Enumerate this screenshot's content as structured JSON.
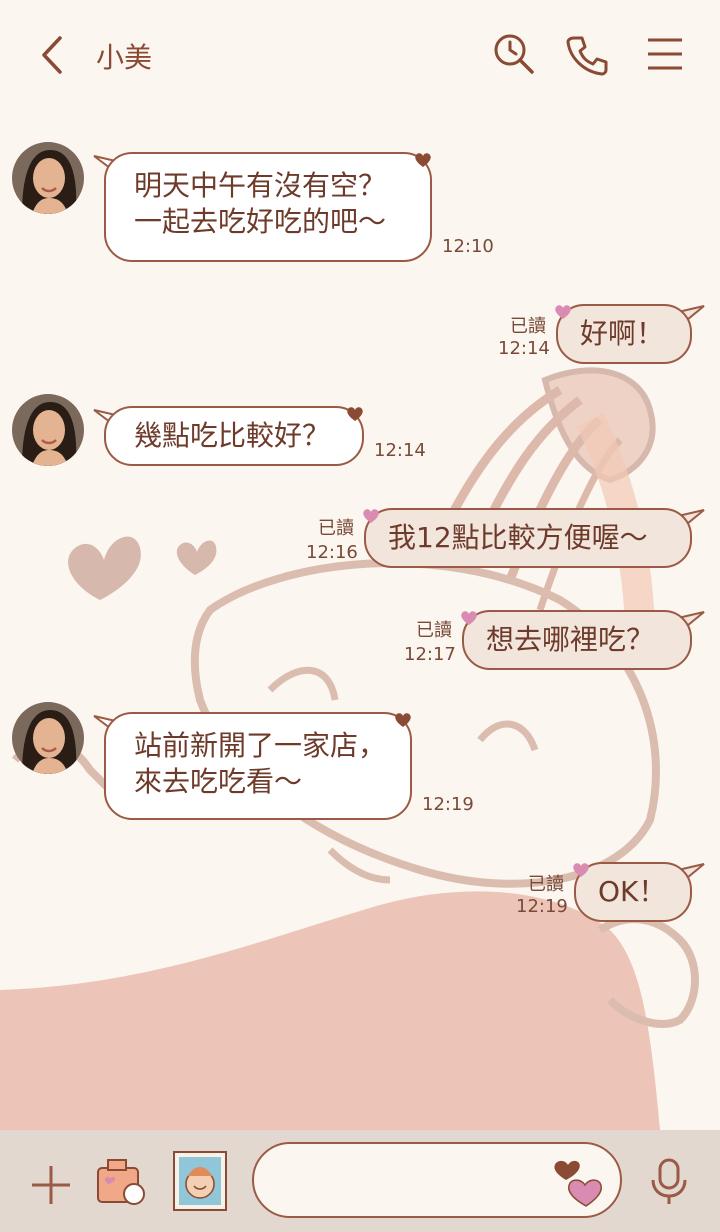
{
  "header": {
    "contact_name": "小美",
    "icons": [
      "back-icon",
      "search-icon",
      "phone-icon",
      "menu-icon"
    ]
  },
  "messages": [
    {
      "side": "in",
      "text": "明天中午有沒有空？\n一起去吃好吃的吧～",
      "time": "12:10",
      "read": ""
    },
    {
      "side": "out",
      "text": "好啊！",
      "time": "12:14",
      "read": "已讀"
    },
    {
      "side": "in",
      "text": "幾點吃比較好？",
      "time": "12:14",
      "read": ""
    },
    {
      "side": "out",
      "text": "我12點比較方便喔～",
      "time": "12:16",
      "read": "已讀"
    },
    {
      "side": "out",
      "text": "想去哪裡吃？",
      "time": "12:17",
      "read": "已讀"
    },
    {
      "side": "in",
      "text": "站前新開了一家店，\n來去吃吃看～",
      "time": "12:19",
      "read": ""
    },
    {
      "side": "out",
      "text": "OK！",
      "time": "12:19",
      "read": "已讀"
    }
  ],
  "composer": {
    "value": "",
    "icons": [
      "plus-icon",
      "camera-icon",
      "photo-icon",
      "sticker-icon",
      "mic-icon"
    ]
  },
  "colors": {
    "accent": "#9a5a45",
    "background": "#fbf6ef",
    "outgoing_bubble": "#f2e5dc",
    "incoming_bubble": "#ffffff",
    "bottom_bar": "#e3d8cf",
    "heart_pink": "#d98bb2",
    "heart_brown": "#8a4a33"
  }
}
